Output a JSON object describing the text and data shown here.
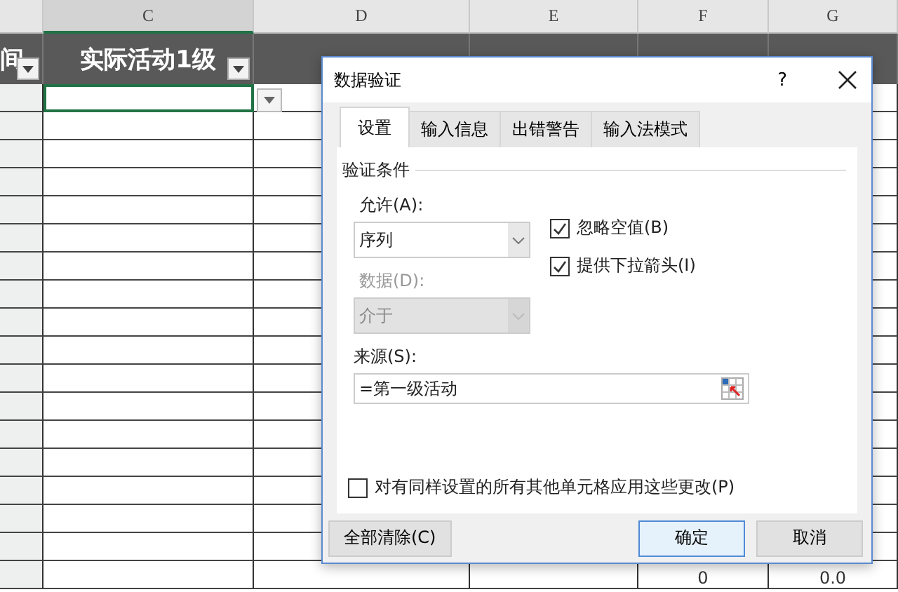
{
  "column_letters": [
    "C",
    "D",
    "E",
    "F",
    "G"
  ],
  "header_row": [
    {
      "text": "间",
      "filter": true
    },
    {
      "text": "实际活动1级",
      "filter": true
    }
  ],
  "last_row": {
    "column_f": "0",
    "column_g": "0.0"
  },
  "dialog": {
    "title": "数据验证",
    "help": "?",
    "tabs": [
      {
        "label": "设置",
        "selected": true
      },
      {
        "label": "输入信息",
        "selected": false
      },
      {
        "label": "出错警告",
        "selected": false
      },
      {
        "label": "输入法模式",
        "selected": false
      }
    ],
    "section": "验证条件",
    "allow_label": "允许(A):",
    "allow_value": "序列",
    "data_label": "数据(D):",
    "data_value": "介于",
    "data_disabled": true,
    "checkboxes": [
      {
        "label": "忽略空值(B)",
        "checked": true
      },
      {
        "label": "提供下拉箭头(I)",
        "checked": true
      }
    ],
    "source_label": "来源(S):",
    "source_value": "=第一级活动",
    "apply_all": {
      "label": "对有同样设置的所有其他单元格应用这些更改(P)",
      "checked": false
    },
    "clear_button": "全部清除(C)",
    "ok_button": "确定",
    "cancel_button": "取消"
  }
}
